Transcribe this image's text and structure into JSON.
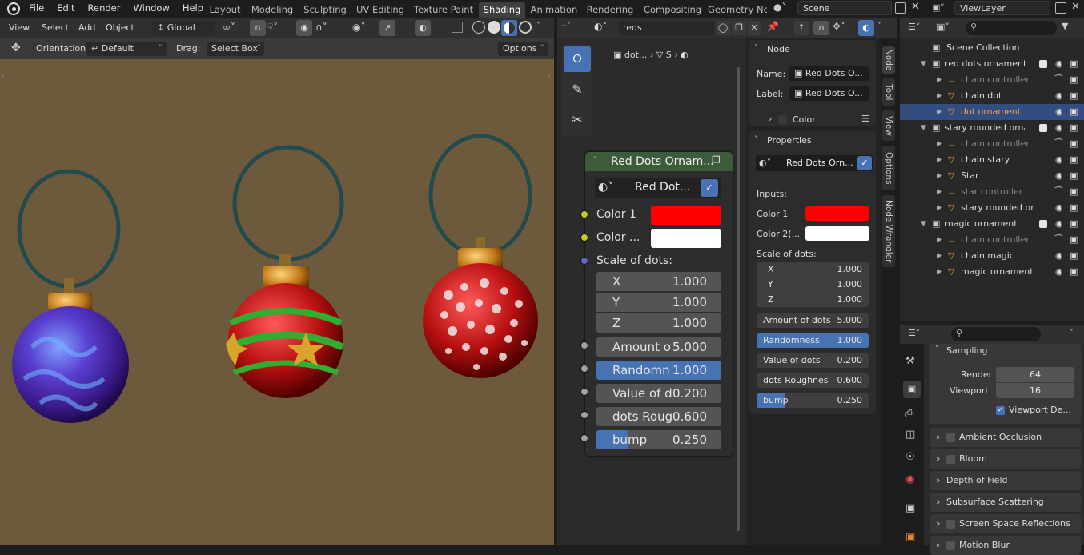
{
  "menu": [
    "File",
    "Edit",
    "Render",
    "Window",
    "Help"
  ],
  "workspaces": [
    {
      "label": "Layout",
      "active": false
    },
    {
      "label": "Modeling",
      "active": false
    },
    {
      "label": "Sculpting",
      "active": false
    },
    {
      "label": "UV Editing",
      "active": false
    },
    {
      "label": "Texture Paint",
      "active": false
    },
    {
      "label": "Shading",
      "active": true
    },
    {
      "label": "Animation",
      "active": false
    },
    {
      "label": "Rendering",
      "active": false
    },
    {
      "label": "Compositing",
      "active": false
    },
    {
      "label": "Geometry Nc",
      "active": false
    }
  ],
  "scene": "Scene",
  "view_layer": "ViewLayer",
  "viewport_header": {
    "view": "View",
    "select": "Select",
    "add": "Add",
    "object": "Object",
    "transform": "Global"
  },
  "viewport_tool": {
    "orientation_label": "Orientation:",
    "orientation": "Default",
    "drag_label": "Drag:",
    "drag": "Select Box",
    "options": "Options"
  },
  "node_header": {
    "material": "reds",
    "breadcrumb_obj": "dot...",
    "breadcrumb_mat": "S"
  },
  "node": {
    "title": "Red Dots Ornam...",
    "group": "Red Dot...",
    "color1_label": "Color 1",
    "color2_label": "Color ...",
    "scale_label": "Scale of dots:",
    "fields": [
      {
        "label": "X",
        "value": "1.000"
      },
      {
        "label": "Y",
        "value": "1.000"
      },
      {
        "label": "Z",
        "value": "1.000"
      },
      {
        "label": "Amount o",
        "value": "5.000"
      },
      {
        "label": "Randomn",
        "value": "1.000"
      },
      {
        "label": "Value of d",
        "value": "0.200"
      },
      {
        "label": "dots Roug",
        "value": "0.600"
      },
      {
        "label": "bump",
        "value": "0.250"
      }
    ]
  },
  "npanel": {
    "node_header": "Node",
    "name_label": "Name:",
    "name": "Red Dots O...",
    "label_label": "Label:",
    "label": "Red Dots O...",
    "color": "Color",
    "properties": "Properties",
    "group": "Red Dots Orn...",
    "inputs": "Inputs:",
    "color1": "Color 1",
    "color2": "Color 2(...",
    "scale": "Scale of dots:",
    "fields": [
      {
        "label": "X",
        "value": "1.000"
      },
      {
        "label": "Y",
        "value": "1.000"
      },
      {
        "label": "Z",
        "value": "1.000"
      },
      {
        "label": "Amount of dots",
        "value": "5.000"
      },
      {
        "label": "Randomness",
        "value": "1.000"
      },
      {
        "label": "Value of dots",
        "value": "0.200"
      },
      {
        "label": "dots Roughnes",
        "value": "0.600"
      },
      {
        "label": "bump",
        "value": "0.250"
      }
    ]
  },
  "side_tabs": [
    "Node",
    "Tool",
    "View",
    "Options",
    "Node Wrangler"
  ],
  "outliner": {
    "collection": "Scene Collection",
    "rows": [
      {
        "label": "red dots ornament",
        "indent": 0,
        "kind": "coll",
        "dim": false,
        "sel": false
      },
      {
        "label": "chain controller",
        "indent": 1,
        "kind": "curve",
        "dim": true,
        "sel": false
      },
      {
        "label": "chain dot",
        "indent": 1,
        "kind": "mesh",
        "dim": false,
        "sel": false
      },
      {
        "label": "dot ornament",
        "indent": 1,
        "kind": "mesh",
        "dim": false,
        "sel": true
      },
      {
        "label": "stary rounded ornam",
        "indent": 0,
        "kind": "coll",
        "dim": false,
        "sel": false
      },
      {
        "label": "chain controller",
        "indent": 1,
        "kind": "curve",
        "dim": true,
        "sel": false
      },
      {
        "label": "chain stary",
        "indent": 1,
        "kind": "mesh",
        "dim": false,
        "sel": false
      },
      {
        "label": "Star",
        "indent": 1,
        "kind": "mesh",
        "dim": false,
        "sel": false
      },
      {
        "label": "star controller",
        "indent": 1,
        "kind": "curve",
        "dim": true,
        "sel": false
      },
      {
        "label": "stary rounded or",
        "indent": 1,
        "kind": "mesh",
        "dim": false,
        "sel": false
      },
      {
        "label": "magic ornament",
        "indent": 0,
        "kind": "coll",
        "dim": false,
        "sel": false
      },
      {
        "label": "chain controller",
        "indent": 1,
        "kind": "curve",
        "dim": true,
        "sel": false
      },
      {
        "label": "chain magic",
        "indent": 1,
        "kind": "mesh",
        "dim": false,
        "sel": false
      },
      {
        "label": "magic ornament",
        "indent": 1,
        "kind": "mesh",
        "dim": false,
        "sel": false
      }
    ]
  },
  "properties": {
    "sampling": "Sampling",
    "render_label": "Render",
    "render": "64",
    "viewport_label": "Viewport",
    "viewport": "16",
    "viewport_denoise": "Viewport De...",
    "sections": [
      "Ambient Occlusion",
      "Bloom",
      "Depth of Field",
      "Subsurface Scattering",
      "Screen Space Reflections",
      "Motion Blur"
    ],
    "checkbox_sections": [
      true,
      true,
      false,
      false,
      true,
      true
    ]
  },
  "colors": {
    "accent": "#4772b3",
    "red": "#ff0000",
    "white": "#ffffff",
    "node_header": "#3b5b3a",
    "bg_viewport": "#6d5a3d"
  }
}
